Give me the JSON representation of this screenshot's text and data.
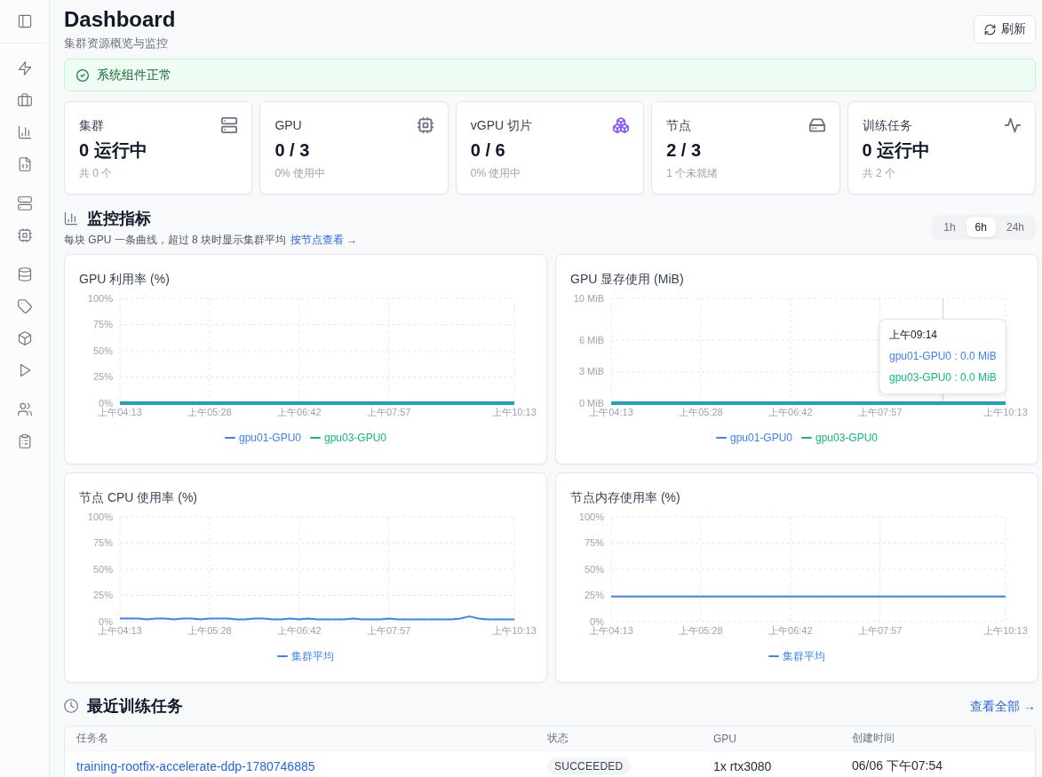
{
  "header": {
    "title": "Dashboard",
    "subtitle": "集群资源概览与监控",
    "refresh_button": "刷新"
  },
  "alert": {
    "message": "系统组件正常"
  },
  "stats": [
    {
      "kind": "cluster",
      "label": "集群",
      "value": "0 运行中",
      "subtext": "共 0 个",
      "color": "#6b7280"
    },
    {
      "kind": "gpu",
      "label": "GPU",
      "value": "0 / 3",
      "subtext": "0% 使用中",
      "color": "#6b7280"
    },
    {
      "kind": "vgpu",
      "label": "vGPU 切片",
      "value": "0 / 6",
      "subtext": "0% 使用中",
      "color": "#8b5cf6"
    },
    {
      "kind": "node",
      "label": "节点",
      "value": "2 / 3",
      "subtext": "1 个未就绪",
      "color": "#6b7280"
    },
    {
      "kind": "job",
      "label": "训练任务",
      "value": "0 运行中",
      "subtext": "共 2 个",
      "color": "#6b7280"
    }
  ],
  "monitoring": {
    "title": "监控指标",
    "hint": "每块 GPU 一条曲线，超过 8 块时显示集群平均",
    "link": "按节点查看 →",
    "time_ranges": [
      {
        "label": "1h",
        "selected": false
      },
      {
        "label": "6h",
        "selected": true
      },
      {
        "label": "24h",
        "selected": false
      }
    ],
    "charts": [
      {
        "chart_data": {
          "type": "line",
          "title": "GPU 利用率 (%)",
          "categories": [
            "上午04:13",
            null,
            null,
            null,
            null,
            null,
            null,
            null,
            null,
            null,
            "上午05:28",
            null,
            null,
            null,
            null,
            null,
            null,
            null,
            null,
            null,
            "上午06:42",
            null,
            null,
            null,
            null,
            null,
            null,
            null,
            null,
            null,
            "上午07:57",
            null,
            null,
            null,
            null,
            null,
            null,
            null,
            null,
            null,
            null,
            null,
            null,
            null,
            "上午10:13"
          ],
          "ylim": [
            0,
            100
          ],
          "yticks": [
            {
              "value": 0,
              "label": "0%"
            },
            {
              "value": 25,
              "label": "25%"
            },
            {
              "value": 50,
              "label": "50%"
            },
            {
              "value": 75,
              "label": "75%"
            },
            {
              "value": 100,
              "label": "100%"
            }
          ],
          "grid": true,
          "legend": true,
          "series": [
            {
              "name": "gpu01-GPU0",
              "color": "#3b82f6",
              "values": [
                0,
                0,
                0,
                0,
                0,
                0,
                0,
                0,
                0,
                0,
                0,
                0,
                0,
                0,
                0,
                0,
                0,
                0,
                0,
                0,
                0,
                0,
                0,
                0,
                0,
                0,
                0,
                0,
                0,
                0,
                0,
                0,
                0,
                0,
                0,
                0,
                0,
                0,
                0,
                0,
                0,
                0,
                0,
                0,
                0
              ]
            },
            {
              "name": "gpu03-GPU0",
              "color": "#10b981",
              "values": [
                0,
                0,
                0,
                0,
                0,
                0,
                0,
                0,
                0,
                0,
                0,
                0,
                0,
                0,
                0,
                0,
                0,
                0,
                0,
                0,
                0,
                0,
                0,
                0,
                0,
                0,
                0,
                0,
                0,
                0,
                0,
                0,
                0,
                0,
                0,
                0,
                0,
                0,
                0,
                0,
                0,
                0,
                0,
                0,
                0
              ]
            }
          ]
        }
      },
      {
        "chart_data": {
          "type": "line",
          "title": "GPU 显存使用 (MiB)",
          "categories": [
            "上午04:13",
            null,
            null,
            null,
            null,
            null,
            null,
            null,
            null,
            null,
            "上午05:28",
            null,
            null,
            null,
            null,
            null,
            null,
            null,
            null,
            null,
            "上午06:42",
            null,
            null,
            null,
            null,
            null,
            null,
            null,
            null,
            null,
            "上午07:57",
            null,
            null,
            null,
            null,
            null,
            null,
            null,
            null,
            null,
            null,
            null,
            null,
            null,
            "上午10:13"
          ],
          "ylim": [
            0,
            10
          ],
          "yticks": [
            {
              "value": 0,
              "label": "0 MiB"
            },
            {
              "value": 3,
              "label": "3 MiB"
            },
            {
              "value": 6,
              "label": "6 MiB"
            },
            {
              "value": 10,
              "label": "10 MiB"
            }
          ],
          "grid": true,
          "legend": true,
          "series": [
            {
              "name": "gpu01-GPU0",
              "color": "#3b82f6",
              "values": [
                0,
                0,
                0,
                0,
                0,
                0,
                0,
                0,
                0,
                0,
                0,
                0,
                0,
                0,
                0,
                0,
                0,
                0,
                0,
                0,
                0,
                0,
                0,
                0,
                0,
                0,
                0,
                0,
                0,
                0,
                0,
                0,
                0,
                0,
                0,
                0,
                0,
                0,
                0,
                0,
                0,
                0,
                0,
                0,
                0
              ]
            },
            {
              "name": "gpu03-GPU0",
              "color": "#10b981",
              "values": [
                0,
                0,
                0,
                0,
                0,
                0,
                0,
                0,
                0,
                0,
                0,
                0,
                0,
                0,
                0,
                0,
                0,
                0,
                0,
                0,
                0,
                0,
                0,
                0,
                0,
                0,
                0,
                0,
                0,
                0,
                0,
                0,
                0,
                0,
                0,
                0,
                0,
                0,
                0,
                0,
                0,
                0,
                0,
                0,
                0
              ]
            }
          ]
        },
        "tooltip": {
          "title": "上午09:14",
          "rows": [
            {
              "text": "gpu01-GPU0 : 0.0 MiB",
              "color": "#3b82f6"
            },
            {
              "text": "gpu03-GPU0 : 0.0 MiB",
              "color": "#10b981"
            }
          ]
        }
      },
      {
        "chart_data": {
          "type": "line",
          "title": "节点 CPU 使用率 (%)",
          "categories": [
            "上午04:13",
            null,
            null,
            null,
            null,
            null,
            null,
            null,
            null,
            null,
            "上午05:28",
            null,
            null,
            null,
            null,
            null,
            null,
            null,
            null,
            null,
            "上午06:42",
            null,
            null,
            null,
            null,
            null,
            null,
            null,
            null,
            null,
            "上午07:57",
            null,
            null,
            null,
            null,
            null,
            null,
            null,
            null,
            null,
            null,
            null,
            null,
            null,
            "上午10:13"
          ],
          "ylim": [
            0,
            100
          ],
          "yticks": [
            {
              "value": 0,
              "label": "0%"
            },
            {
              "value": 25,
              "label": "25%"
            },
            {
              "value": 50,
              "label": "50%"
            },
            {
              "value": 75,
              "label": "75%"
            },
            {
              "value": 100,
              "label": "100%"
            }
          ],
          "grid": true,
          "legend": true,
          "series": [
            {
              "name": "集群平均",
              "color": "#3b82f6",
              "values": [
                3,
                3,
                3,
                2,
                3,
                3,
                2,
                3,
                3,
                2,
                3,
                3,
                3,
                2,
                2,
                3,
                3,
                2,
                2,
                3,
                2,
                3,
                2,
                2,
                2,
                2,
                3,
                2,
                2,
                2,
                3,
                2,
                2,
                2,
                2,
                2,
                2,
                2,
                3,
                5,
                3,
                2,
                2,
                2,
                2
              ]
            }
          ]
        }
      },
      {
        "chart_data": {
          "type": "line",
          "title": "节点内存使用率 (%)",
          "categories": [
            "上午04:13",
            null,
            null,
            null,
            null,
            null,
            null,
            null,
            null,
            null,
            "上午05:28",
            null,
            null,
            null,
            null,
            null,
            null,
            null,
            null,
            null,
            "上午06:42",
            null,
            null,
            null,
            null,
            null,
            null,
            null,
            null,
            null,
            "上午07:57",
            null,
            null,
            null,
            null,
            null,
            null,
            null,
            null,
            null,
            null,
            null,
            null,
            null,
            "上午10:13"
          ],
          "ylim": [
            0,
            100
          ],
          "yticks": [
            {
              "value": 0,
              "label": "0%"
            },
            {
              "value": 25,
              "label": "25%"
            },
            {
              "value": 50,
              "label": "50%"
            },
            {
              "value": 75,
              "label": "75%"
            },
            {
              "value": 100,
              "label": "100%"
            }
          ],
          "grid": true,
          "legend": true,
          "series": [
            {
              "name": "集群平均",
              "color": "#3b82f6",
              "values": [
                24,
                24,
                24,
                24,
                24,
                24,
                24,
                24,
                24,
                24,
                24,
                24,
                24,
                24,
                24,
                24,
                24,
                24,
                24,
                24,
                24,
                24,
                24,
                24,
                24,
                24,
                24,
                24,
                24,
                24,
                24,
                24,
                24,
                24,
                24,
                24,
                24,
                24,
                24,
                24,
                24,
                24,
                24,
                24,
                24
              ]
            }
          ]
        }
      }
    ]
  },
  "recent_jobs": {
    "title": "最近训练任务",
    "link": "查看全部 →",
    "columns": [
      "任务名",
      "状态",
      "GPU",
      "创建时间"
    ],
    "rows": [
      {
        "name": "training-rootfix-accelerate-ddp-1780746885",
        "status": "SUCCEEDED",
        "gpu": "1x rtx3080",
        "created": "06/06 下午07:54"
      }
    ]
  }
}
